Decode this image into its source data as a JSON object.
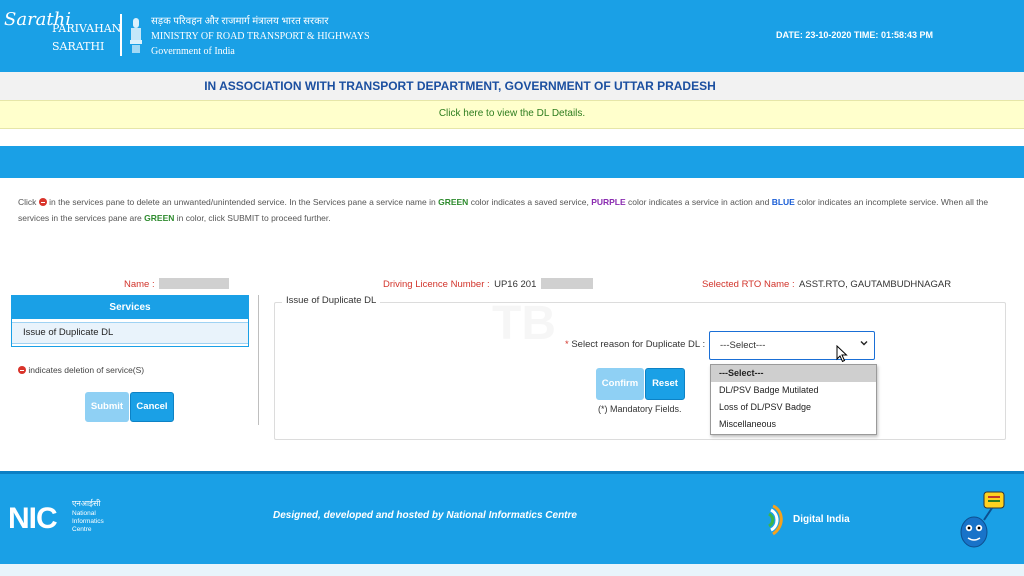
{
  "header": {
    "logo_glyph": "Sarathi",
    "logo_name_line1": "PARIVAHAN",
    "logo_name_line2": "SARATHI",
    "ministry_hindi": "सड़क परिवहन और राजमार्ग मंत्रालय भारत सरकार",
    "ministry_line1": "MINISTRY OF ROAD TRANSPORT & HIGHWAYS",
    "ministry_line2": "Government of India",
    "date_label": "DATE:",
    "date_value": "23-10-2020",
    "time_label": "TIME:",
    "time_value": "01:58:43 PM"
  },
  "association_text": "IN ASSOCIATION WITH TRANSPORT DEPARTMENT, GOVERNMENT OF UTTAR PRADESH",
  "dl_details_link": "Click here to view the DL Details.",
  "instructions": {
    "p1": "Click",
    "p2": "in the services pane to delete an unwanted/unintended service. In the Services pane a service name in",
    "green": "GREEN",
    "p3": "color indicates a saved service,",
    "purple": "PURPLE",
    "p4": "color indicates a service in action and",
    "blue": "BLUE",
    "p5": "color indicates an incomplete service. When all the services in the services pane are",
    "green2": "GREEN",
    "p6": "in color, click SUBMIT to proceed further."
  },
  "info": {
    "name_label": "Name :",
    "dl_label": "Driving Licence Number :",
    "dl_value": "UP16 201",
    "rto_label": "Selected RTO Name :",
    "rto_value": "ASST.RTO, GAUTAMBUDHNAGAR"
  },
  "services": {
    "heading": "Services",
    "items": [
      "Issue of Duplicate DL"
    ],
    "deletion_note": "indicates deletion of service(S)",
    "submit_label": "Submit",
    "cancel_label": "Cancel"
  },
  "form": {
    "legend": "Issue of Duplicate DL",
    "reason_label": "Select reason for Duplicate DL :",
    "mandatory_star": "*",
    "select_value": "---Select---",
    "options": [
      "---Select---",
      "DL/PSV Badge Mutilated",
      "Loss of DL/PSV Badge",
      "Miscellaneous"
    ],
    "confirm_label": "Confirm",
    "reset_label": "Reset",
    "mandatory_note": "(*) Mandatory Fields."
  },
  "watermark": "TB",
  "footer": {
    "nic_hindi": "एनआईसी",
    "nic_name": "National Informatics Centre",
    "nic_abbr": "NIC",
    "hosted_text": "Designed, developed and hosted by National Informatics Centre",
    "digital_india": "Digital India"
  },
  "colors": {
    "primary_blue": "#1aa0e6",
    "link_green": "#2e7d1f",
    "label_red": "#d2342b",
    "association_blue": "#1b4fa0"
  }
}
